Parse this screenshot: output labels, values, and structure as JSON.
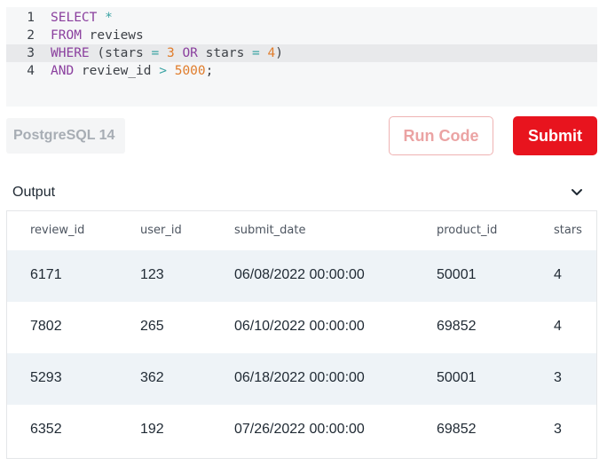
{
  "editor": {
    "lines": [
      {
        "num": "1",
        "tokens": [
          [
            "kw",
            "SELECT"
          ],
          [
            "pun",
            " "
          ],
          [
            "op",
            "*"
          ]
        ]
      },
      {
        "num": "2",
        "tokens": [
          [
            "kw",
            "FROM"
          ],
          [
            "id",
            " reviews"
          ]
        ]
      },
      {
        "num": "3",
        "tokens": [
          [
            "kw",
            "WHERE"
          ],
          [
            "pun",
            " ("
          ],
          [
            "id",
            "stars"
          ],
          [
            "pun",
            " "
          ],
          [
            "op",
            "="
          ],
          [
            "pun",
            " "
          ],
          [
            "num",
            "3"
          ],
          [
            "pun",
            " "
          ],
          [
            "kw",
            "OR"
          ],
          [
            "id",
            " stars"
          ],
          [
            "pun",
            " "
          ],
          [
            "op",
            "="
          ],
          [
            "pun",
            " "
          ],
          [
            "num",
            "4"
          ],
          [
            "pun",
            ")"
          ]
        ]
      },
      {
        "num": "4",
        "tokens": [
          [
            "kw",
            "AND"
          ],
          [
            "id",
            " review_id"
          ],
          [
            "pun",
            " "
          ],
          [
            "op",
            ">"
          ],
          [
            "pun",
            " "
          ],
          [
            "num",
            "5000"
          ],
          [
            "pun",
            ";"
          ]
        ]
      }
    ],
    "active_line": 3
  },
  "toolbar": {
    "dialect_label": "PostgreSQL 14",
    "run_label": "Run Code",
    "submit_label": "Submit"
  },
  "output": {
    "title": "Output",
    "chevron_icon": "chevron-down-icon",
    "columns": [
      "review_id",
      "user_id",
      "submit_date",
      "product_id",
      "stars"
    ],
    "rows": [
      [
        "6171",
        "123",
        "06/08/2022 00:00:00",
        "50001",
        "4"
      ],
      [
        "7802",
        "265",
        "06/10/2022 00:00:00",
        "69852",
        "4"
      ],
      [
        "5293",
        "362",
        "06/18/2022 00:00:00",
        "50001",
        "3"
      ],
      [
        "6352",
        "192",
        "07/26/2022 00:00:00",
        "69852",
        "3"
      ]
    ]
  },
  "colors": {
    "accent": "#e8141e",
    "row_shade": "#eef3f7"
  }
}
